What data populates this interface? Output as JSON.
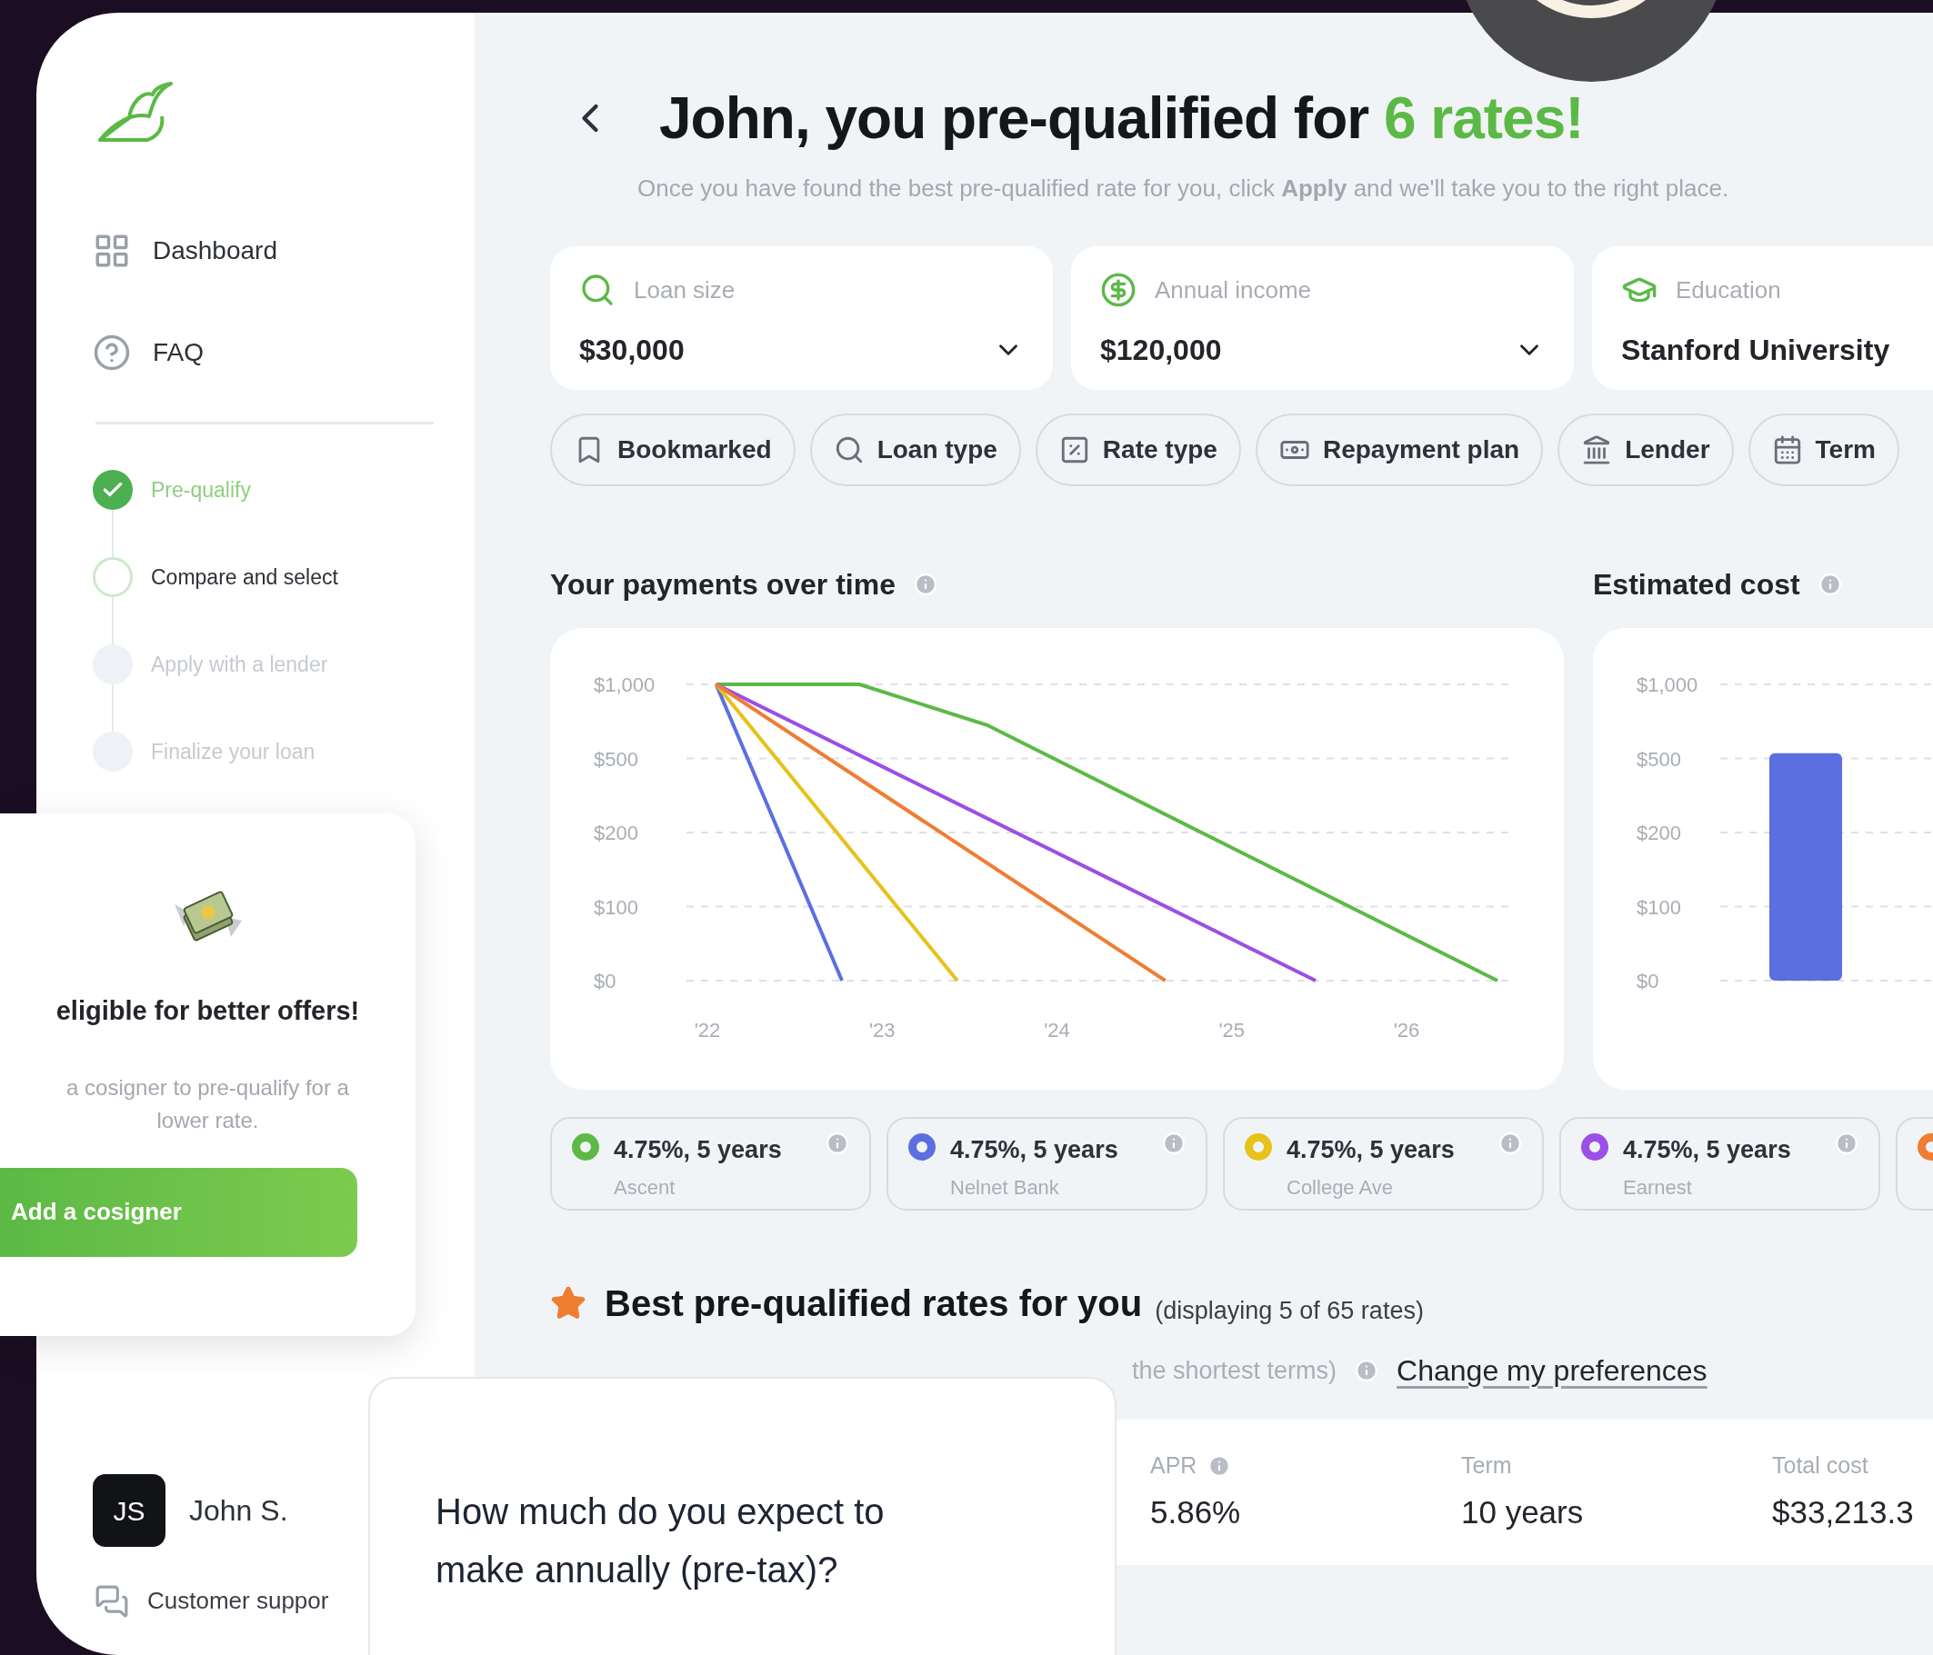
{
  "sidebar": {
    "nav": [
      {
        "label": "Dashboard"
      },
      {
        "label": "FAQ"
      }
    ],
    "steps": [
      {
        "label": "Pre-qualify",
        "done": true,
        "active": false
      },
      {
        "label": "Compare and select",
        "done": false,
        "active": true
      },
      {
        "label": "Apply with a lender",
        "done": false,
        "active": false
      },
      {
        "label": "Finalize your loan",
        "done": false,
        "active": false
      }
    ],
    "user": {
      "initials": "JS",
      "name": "John S."
    },
    "support": "Customer suppor"
  },
  "header": {
    "title": "John, you pre-qualified for ",
    "title_highlight": "6 rates!",
    "subtitle": "Once you have found the best pre-qualified rate for you, click **Apply** and we'll take you to the right place."
  },
  "fields": [
    {
      "label": "Loan size",
      "value": "$30,000",
      "dropdown": true
    },
    {
      "label": "Annual income",
      "value": "$120,000",
      "dropdown": true
    },
    {
      "label": "Education",
      "value": "Stanford University"
    }
  ],
  "filters": [
    {
      "label": "Bookmarked"
    },
    {
      "label": "Loan type"
    },
    {
      "label": "Rate type"
    },
    {
      "label": "Repayment plan"
    },
    {
      "label": "Lender"
    },
    {
      "label": "Term"
    }
  ],
  "payments_chart": {
    "title": "Your payments over time",
    "y_labels": [
      "$1,000",
      "$500",
      "$200",
      "$100",
      "$0"
    ],
    "x_labels": [
      "'22",
      "'23",
      "'24",
      "'25",
      "'26"
    ]
  },
  "cost_chart": {
    "title": "Estimated cost",
    "y_labels": [
      "$1,000",
      "$500",
      "$200",
      "$100",
      "$0"
    ]
  },
  "legend": [
    {
      "rate": "4.75%, 5 years",
      "lender": "Ascent",
      "color": "#5cb946"
    },
    {
      "rate": "4.75%, 5 years",
      "lender": "Nelnet Bank",
      "color": "#5b6fe0"
    },
    {
      "rate": "4.75%, 5 years",
      "lender": "College Ave",
      "color": "#e6c21a"
    },
    {
      "rate": "4.75%, 5 years",
      "lender": "Earnest",
      "color": "#9b4fe6"
    },
    {
      "color": "#ef7d32"
    }
  ],
  "best": {
    "title": "Best pre-qualified rates for you",
    "count": "(displaying 5 of 65 rates)",
    "note": "the shortest terms)",
    "link": "Change my preferences",
    "columns": [
      {
        "label": "APR",
        "value": "5.86%",
        "info": true
      },
      {
        "label": "Term",
        "value": "10 years"
      },
      {
        "label": "Total cost",
        "value": "$33,213.3"
      }
    ]
  },
  "cosigner_card": {
    "title": "eligible for better offers!",
    "text": "a cosigner to pre-qualify for a lower rate.",
    "button": "Add a cosigner"
  },
  "question_card": {
    "text": "How much do you expect to make annually (pre-tax)?"
  }
}
